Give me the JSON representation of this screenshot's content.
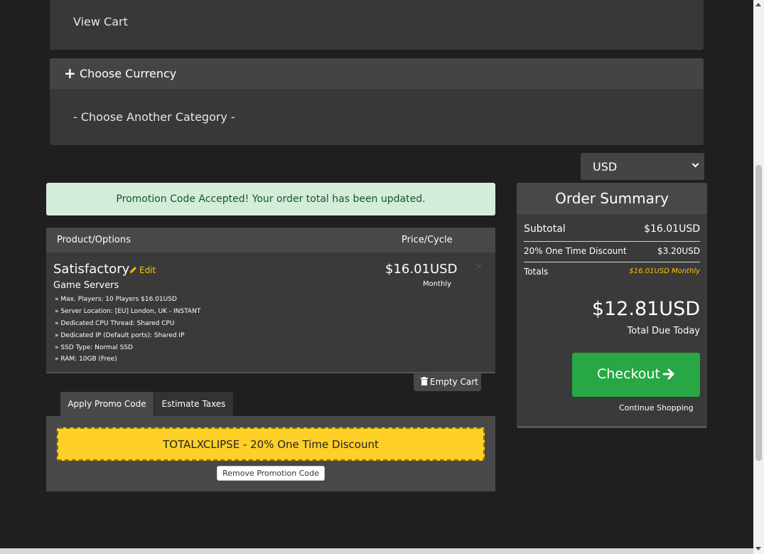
{
  "top_panel": {
    "view_cart": "View Cart"
  },
  "currency_panel": {
    "plus_symbol": "+",
    "heading": "Choose Currency",
    "category_link": "- Choose Another Category -"
  },
  "currency_select": {
    "value": "USD"
  },
  "alert": {
    "message": "Promotion Code Accepted! Your order total has been updated."
  },
  "cart": {
    "col_product": "Product/Options",
    "col_price": "Price/Cycle",
    "product_name": "Satisfactory",
    "edit_label": "Edit",
    "product_group": "Game Servers",
    "options": [
      "» Max. Players: 10 Players $16.01USD",
      "» Server Location: [EU] London, UK - INSTANT",
      "» Dedicated CPU Thread: Shared CPU",
      "» Dedicated IP (Default ports): Shared IP",
      "» SSD Type: Normal SSD",
      "» RAM: 10GB (Free)"
    ],
    "price": "$16.01USD",
    "cycle": "Monthly",
    "remove_symbol": "×",
    "empty_cart_label": "Empty Cart"
  },
  "tabs": {
    "promo": "Apply Promo Code",
    "taxes": "Estimate Taxes"
  },
  "promo": {
    "code_text": "TOTALXCLIPSE - 20% One Time Discount",
    "remove_label": "Remove Promotion Code"
  },
  "summary": {
    "title": "Order Summary",
    "subtotal_label": "Subtotal",
    "subtotal_value": "$16.01USD",
    "discount_label": "20% One Time Discount",
    "discount_value": "$3.20USD",
    "totals_label": "Totals",
    "totals_value": "$16.01USD Monthly",
    "total_due": "$12.81USD",
    "total_due_label": "Total Due Today",
    "checkout_label": "Checkout",
    "continue_label": "Continue Shopping"
  },
  "colors": {
    "page_bg": "#1f1f1f",
    "panel_bg": "#383838",
    "alert_bg": "#d4edda",
    "alert_text": "#155724",
    "accent_yellow": "#ffc107",
    "promo_bg": "#ffd027",
    "checkout_green": "#28a745"
  },
  "icons": [
    "plus-icon",
    "pencil-icon",
    "remove-icon",
    "trash-icon",
    "arrow-right-icon",
    "chevron-down-icon"
  ]
}
